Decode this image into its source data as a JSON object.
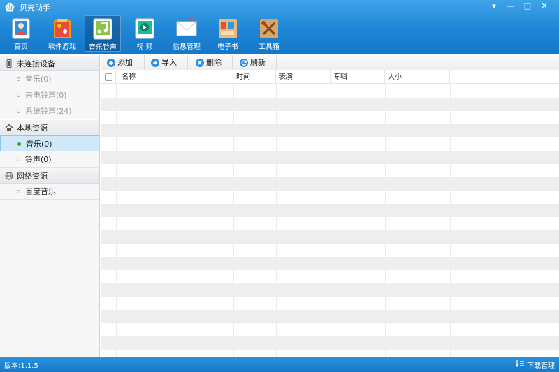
{
  "window": {
    "title": "贝壳助手",
    "controls": {
      "menu": "▾",
      "minimize": "—",
      "maximize": "□",
      "close": "✕"
    }
  },
  "nav": {
    "items": [
      {
        "label": "首页",
        "icon": "home-icon"
      },
      {
        "label": "软件游戏",
        "icon": "apps-games-icon"
      },
      {
        "label": "音乐铃声",
        "icon": "music-icon",
        "active": true
      },
      {
        "label": "视  频",
        "icon": "video-icon"
      },
      {
        "label": "信息管理",
        "icon": "message-icon"
      },
      {
        "label": "电子书",
        "icon": "ebook-icon"
      },
      {
        "label": "工具箱",
        "icon": "toolbox-icon"
      }
    ]
  },
  "sidebar": {
    "groups": [
      {
        "label": "未连接设备",
        "icon": "phone-icon",
        "items": [
          {
            "label": "音乐(0)"
          },
          {
            "label": "来电铃声(0)"
          },
          {
            "label": "系统铃声(24)"
          }
        ]
      },
      {
        "label": "本地资源",
        "icon": "house-icon",
        "items": [
          {
            "label": "音乐(0)",
            "active": true
          },
          {
            "label": "铃声(0)"
          }
        ]
      },
      {
        "label": "网络资源",
        "icon": "globe-icon",
        "items": [
          {
            "label": "百度音乐"
          }
        ]
      }
    ]
  },
  "toolbar": {
    "add": "添加",
    "import": "导入",
    "delete": "删除",
    "refresh": "刷新"
  },
  "table": {
    "columns": [
      "名称",
      "时间",
      "表演",
      "专辑",
      "大小"
    ],
    "rows": []
  },
  "statusbar": {
    "version": "版本:1.1.5",
    "download_manager": "下载管理"
  },
  "colors": {
    "header_blue": "#1e86d6",
    "selection": "#cfe9f9",
    "active_dot": "#3aa52c"
  }
}
